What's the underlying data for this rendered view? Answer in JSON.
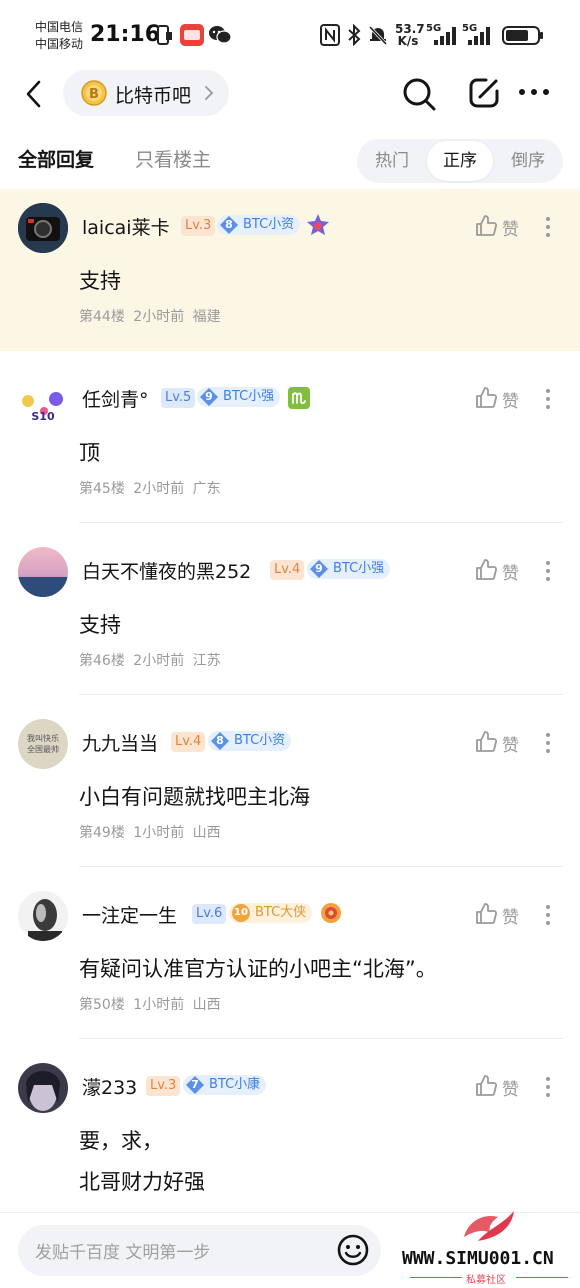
{
  "status_bar": {
    "carrier_1": "中国电信",
    "carrier_2": "中国移动",
    "time": "21:16",
    "net_speed_value": "53.7",
    "net_speed_unit": "K/s",
    "signal_1_label": "5G",
    "signal_2_label": "5G",
    "icons": [
      "sim-icon",
      "app-notification-icon",
      "wechat-icon",
      "nfc-icon",
      "bluetooth-icon",
      "mute-bell-icon",
      "signal-icon",
      "battery-icon"
    ]
  },
  "header": {
    "back_icon": "chevron-left-icon",
    "forum_name": "比特币吧",
    "forum_icon": "bitcoin-icon",
    "actions": [
      "search-icon",
      "edit-icon",
      "more-icon"
    ]
  },
  "filter": {
    "tab_all": "全部回复",
    "tab_op_only": "只看楼主",
    "sort_options": [
      "热门",
      "正序",
      "倒序"
    ],
    "sort_selected": "正序"
  },
  "colors": {
    "highlight_bg": "#fcf7e5",
    "badge_blue": "#3d7ee8",
    "badge_gold": "#f0a63c",
    "lv_orange": "#e0843b",
    "lv_blue": "#4a7fd1",
    "accent_red": "#e14b5a"
  },
  "posts": [
    {
      "username": "laicai莱卡",
      "level": "Lv.3",
      "badge_num": "8",
      "badge_text": "BTC小资",
      "like_label": "赞",
      "content": [
        "支持"
      ],
      "floor": "第44楼",
      "time": "2小时前",
      "location": "福建"
    },
    {
      "username": "任剑青°",
      "level": "Lv.5",
      "badge_num": "9",
      "badge_text": "BTC小强",
      "avatar_text": "S10",
      "like_label": "赞",
      "content": [
        "顶"
      ],
      "floor": "第45楼",
      "time": "2小时前",
      "location": "广东"
    },
    {
      "username": "白天不懂夜的黑252",
      "level": "Lv.4",
      "badge_num": "9",
      "badge_text": "BTC小强",
      "like_label": "赞",
      "content": [
        "支持"
      ],
      "floor": "第46楼",
      "time": "2小时前",
      "location": "江苏"
    },
    {
      "username": "九九当当",
      "level": "Lv.4",
      "badge_num": "8",
      "badge_text": "BTC小资",
      "avatar_text_1": "我叫快乐",
      "avatar_text_2": "全国最帅",
      "like_label": "赞",
      "content": [
        "小白有问题就找吧主北海"
      ],
      "floor": "第49楼",
      "time": "1小时前",
      "location": "山西"
    },
    {
      "username": "一注定一生",
      "level": "Lv.6",
      "badge_num": "10",
      "badge_text": "BTC大侠",
      "like_label": "赞",
      "content": [
        "有疑问认准官方认证的小吧主“北海”。"
      ],
      "floor": "第50楼",
      "time": "1小时前",
      "location": "山西"
    },
    {
      "username": "濛233",
      "level": "Lv.3",
      "badge_num": "7",
      "badge_text": "BTC小康",
      "like_label": "赞",
      "content": [
        "要，求，",
        "北哥财力好强"
      ]
    }
  ],
  "bottom_bar": {
    "input_placeholder": "发贴千百度 文明第一步",
    "emoji_icon": "smiley-icon",
    "watermark_text": "WWW.SIMU001.CN",
    "watermark_sub": "私募社区"
  }
}
